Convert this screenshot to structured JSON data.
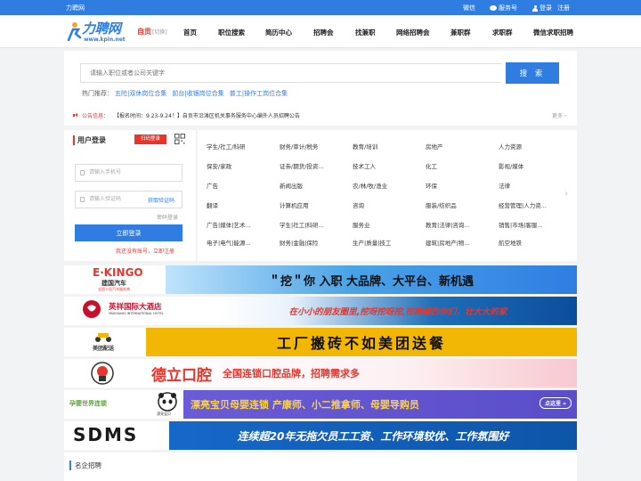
{
  "topbar": {
    "site_name": "力聘网",
    "wechat": "微信",
    "service": "服务号",
    "login": "登录",
    "register": "注册"
  },
  "header": {
    "logo_text": "力聘网",
    "logo_url": "www.kpin.net",
    "city": "自贡",
    "city_switch": "[切换]",
    "nav": [
      "首页",
      "职位搜索",
      "简历中心",
      "招聘会",
      "找兼职",
      "网络招聘会",
      "兼职群",
      "求职群",
      "微信求职招聘"
    ]
  },
  "search": {
    "placeholder": "请输入职位或者公司关键字",
    "button": "搜 索",
    "hot_label": "热门推荐：",
    "hot_items": [
      "五险|双休岗位合集",
      "前台|收银岗位合集",
      "普工|操作工岗位合集"
    ],
    "notice_label": "公告信息：",
    "notice_text": "【报名时间：9.23-9.24！】自贡市沿滩区机关事务服务中心编外人员招聘公告",
    "more": "更多 ›"
  },
  "login": {
    "title": "用户登录",
    "scan": "扫码登录",
    "phone_placeholder": "请输入手机号",
    "code_placeholder": "请输入验证码",
    "get_code": "获取验证码",
    "password_login": "密码登录",
    "submit": "立即登录",
    "register_prompt": "我还没有账号，立即注册"
  },
  "categories": [
    [
      "学生/社工/科研",
      "财务/审计/税务",
      "教育/培训",
      "房地产",
      "人力资源"
    ],
    [
      "保安/家政",
      "证劵/期货/投资...",
      "技术工人",
      "化工",
      "影视/媒体"
    ],
    [
      "广告",
      "新闻出版",
      "农/林/牧/渔业",
      "环保",
      "法律"
    ],
    [
      "翻译",
      "计算机应用",
      "咨询",
      "服装/纺织品",
      "经营管理|人力资..."
    ],
    [
      "广告|媒体|艺术...",
      "学生|社工|科研...",
      "服务业",
      "教育|法律|咨询...",
      "销售|市场|客服..."
    ],
    [
      "电子|电气|能源...",
      "财务|金融|保险",
      "生产|质量|技工",
      "建筑|房地产|物...",
      "航空地铁"
    ]
  ],
  "banners": [
    {
      "brand": "E·KINGO",
      "brand_sub": "建国汽车",
      "brand_sub2": "全国十佳汽车服务商",
      "slogan": "＂挖＂你 入职  大品牌、大平台、新机遇",
      "brand_color": "#e8352c",
      "bg": "#4aa3e6"
    },
    {
      "brand": "英祥国际大酒店",
      "brand_sub": "YINGXIANG INTERNATIONAL HOTEL",
      "slogan": "在小小的朋友圈里,挖呀挖呀挖,挖棒棒的你们，壮大大的家",
      "brand_color": "#c8102e",
      "bg": "#1d6fb8"
    },
    {
      "brand": "美团配送",
      "slogan": "工厂搬砖不如美团送餐",
      "brand_color": "#e5a200",
      "bg": "#f2b705"
    },
    {
      "brand": "德立口腔",
      "slogan": "全国连锁口腔品牌，招聘需求多",
      "brand_color": "#e8352c",
      "bg": "#fbe8ea"
    },
    {
      "brand": "孕婴世界连锁",
      "brand_sub": "漂亮宝贝",
      "slogan": "漂亮宝贝母婴连锁  产康师、小二推拿师、母婴导购员",
      "button": "点这里 »",
      "brand_color": "#5aa832",
      "bg": "#5b4ec9"
    },
    {
      "brand": "SDMS",
      "slogan": "连续超20年无拖欠员工工资、工作环境较优、工作氛围好",
      "brand_color": "#1a1a1a",
      "bg": "#1668c8"
    }
  ],
  "section": {
    "title": "名企招聘"
  }
}
